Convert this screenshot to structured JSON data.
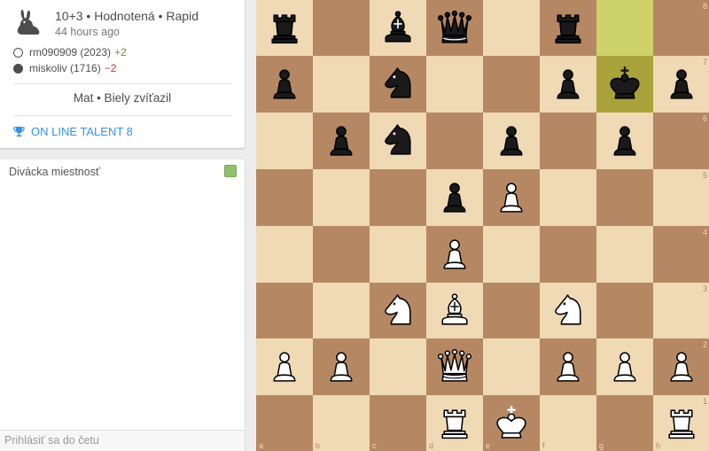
{
  "game": {
    "title": "10+3 • Hodnotená • Rapid",
    "date": "44 hours ago",
    "speed_icon": "rabbit-icon",
    "white_player": {
      "name": "rm090909 (2023)",
      "diff": "+2"
    },
    "black_player": {
      "name": "miskoliv (1716)",
      "diff": "−2"
    },
    "result": "Mat • Biely zvíťazil",
    "tournament": "ON LINE TALENT 8"
  },
  "chat": {
    "title": "Divácka miestnosť",
    "input_placeholder": "Prihlásiť sa do četu"
  },
  "board": {
    "orientation": "white",
    "files": [
      "a",
      "b",
      "c",
      "d",
      "e",
      "f",
      "g",
      "h"
    ],
    "ranks": [
      "8",
      "7",
      "6",
      "5",
      "4",
      "3",
      "2",
      "1"
    ],
    "highlighted": [
      "g8",
      "g7"
    ],
    "pieces": [
      {
        "sq": "a8",
        "p": "bR"
      },
      {
        "sq": "c8",
        "p": "bB"
      },
      {
        "sq": "d8",
        "p": "bQ"
      },
      {
        "sq": "f8",
        "p": "bR"
      },
      {
        "sq": "a7",
        "p": "bP"
      },
      {
        "sq": "c7",
        "p": "bN"
      },
      {
        "sq": "f7",
        "p": "bP"
      },
      {
        "sq": "g7",
        "p": "bK"
      },
      {
        "sq": "h7",
        "p": "bP"
      },
      {
        "sq": "b6",
        "p": "bP"
      },
      {
        "sq": "c6",
        "p": "bN"
      },
      {
        "sq": "e6",
        "p": "bP"
      },
      {
        "sq": "g6",
        "p": "bP"
      },
      {
        "sq": "d5",
        "p": "bP"
      },
      {
        "sq": "e5",
        "p": "wP"
      },
      {
        "sq": "d4",
        "p": "wP"
      },
      {
        "sq": "c3",
        "p": "wN"
      },
      {
        "sq": "d3",
        "p": "wB"
      },
      {
        "sq": "f3",
        "p": "wN"
      },
      {
        "sq": "a2",
        "p": "wP"
      },
      {
        "sq": "b2",
        "p": "wP"
      },
      {
        "sq": "d2",
        "p": "wQ"
      },
      {
        "sq": "f2",
        "p": "wP"
      },
      {
        "sq": "g2",
        "p": "wP"
      },
      {
        "sq": "h2",
        "p": "wP"
      },
      {
        "sq": "d1",
        "p": "wR"
      },
      {
        "sq": "e1",
        "p": "wK"
      },
      {
        "sq": "h1",
        "p": "wR"
      }
    ]
  }
}
